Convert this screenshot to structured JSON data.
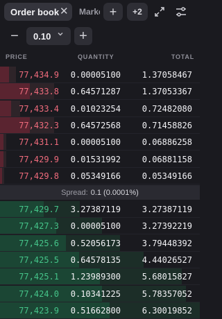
{
  "tabs": {
    "active_label": "Order book",
    "inactive_label": "Market",
    "more_label": "+2"
  },
  "precision": {
    "value": "0.10"
  },
  "columns": {
    "price": "PRICE",
    "quantity": "QUANTITY",
    "total": "TOTAL"
  },
  "asks": [
    {
      "price": "77,434.9",
      "quantity": "0.00005100",
      "total": "1.37058467",
      "depth": 0.08
    },
    {
      "price": "77,433.8",
      "quantity": "0.64571287",
      "total": "1.37053367",
      "depth": 0.27
    },
    {
      "price": "77,433.4",
      "quantity": "0.01023254",
      "total": "0.72482080",
      "depth": 0.1
    },
    {
      "price": "77,432.3",
      "quantity": "0.64572568",
      "total": "0.71458826",
      "depth": 0.27
    },
    {
      "price": "77,431.1",
      "quantity": "0.00005100",
      "total": "0.06886258",
      "depth": 0.03
    },
    {
      "price": "77,429.9",
      "quantity": "0.01531992",
      "total": "0.06881158",
      "depth": 0.03
    },
    {
      "price": "77,429.8",
      "quantity": "0.05349166",
      "total": "0.05349166",
      "depth": 0.02
    }
  ],
  "spread": {
    "label": "Spread:",
    "value": "0.1 (0.0001%)"
  },
  "bids": [
    {
      "price": "77,429.7",
      "quantity": "3.27387119",
      "total": "3.27387119",
      "depth": 0.4
    },
    {
      "price": "77,427.3",
      "quantity": "0.00005100",
      "total": "3.27392219",
      "depth": 0.51
    },
    {
      "price": "77,425.6",
      "quantity": "0.52056173",
      "total": "3.79448392",
      "depth": 0.6
    },
    {
      "price": "77,425.5",
      "quantity": "0.64578135",
      "total": "4.44026527",
      "depth": 0.72
    },
    {
      "price": "77,425.1",
      "quantity": "1.23989300",
      "total": "5.68015827",
      "depth": 0.91
    },
    {
      "price": "77,424.0",
      "quantity": "0.10341225",
      "total": "5.78357052",
      "depth": 0.93
    },
    {
      "price": "77,423.9",
      "quantity": "0.51662800",
      "total": "6.30019852",
      "depth": 1.0
    }
  ],
  "icons": {
    "close": "close-icon",
    "add": "plus-icon",
    "expand": "expand-icon",
    "settings": "sliders-icon",
    "minus": "minus-icon",
    "plus": "plus-icon",
    "chevron": "chevron-down-icon"
  },
  "colors": {
    "ask": "#ef6b7c",
    "bid": "#45c489",
    "background": "#1a1a1f"
  }
}
